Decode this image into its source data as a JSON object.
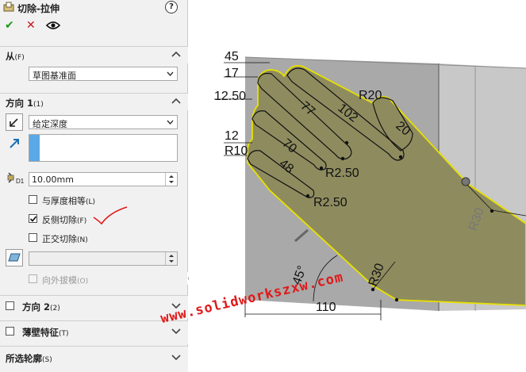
{
  "header": {
    "title": "切除-拉伸",
    "help": "?"
  },
  "actions": {
    "ok": "✔",
    "cancel": "✕"
  },
  "from_group": {
    "label": "从",
    "shortcut": "(F)",
    "end_condition": "草图基准面"
  },
  "direction1": {
    "label": "方向 1",
    "shortcut": "(1)",
    "end_condition": "给定深度",
    "depth": "10.00mm",
    "normal_to_thickness": {
      "label": "与厚度相等",
      "shortcut": "(L)"
    },
    "flip_side": {
      "label": "反侧切除",
      "shortcut": "(F)"
    },
    "cut_normal": {
      "label": "正交切除",
      "shortcut": "(N)"
    },
    "draft_outward": {
      "label": "向外拔模",
      "shortcut": "(O)"
    }
  },
  "direction2": {
    "label": "方向 2",
    "shortcut": "(2)"
  },
  "thin_feature": {
    "label": "薄壁特征",
    "shortcut": "(T)"
  },
  "selected_contours": {
    "label": "所选轮廓",
    "shortcut": "(S)"
  },
  "watermark": "www.solidworkszxw.com",
  "dimensions": {
    "d45": "45",
    "d17": "17",
    "d12_50": "12.50",
    "d12": "12",
    "r10": "R10",
    "d77": "77",
    "d102": "102",
    "d70": "70",
    "d48": "48",
    "r2_50_a": "R2.50",
    "r2_50_b": "R2.50",
    "r20": "R20",
    "d20": "20",
    "ang45": "45°",
    "r30": "R30",
    "r30_b": "R30",
    "d110": "110"
  },
  "colors": {
    "accent": "#e8e000",
    "face": "#8e8c5f",
    "plane": "#a9a9a9",
    "watermark": "#e01818"
  }
}
